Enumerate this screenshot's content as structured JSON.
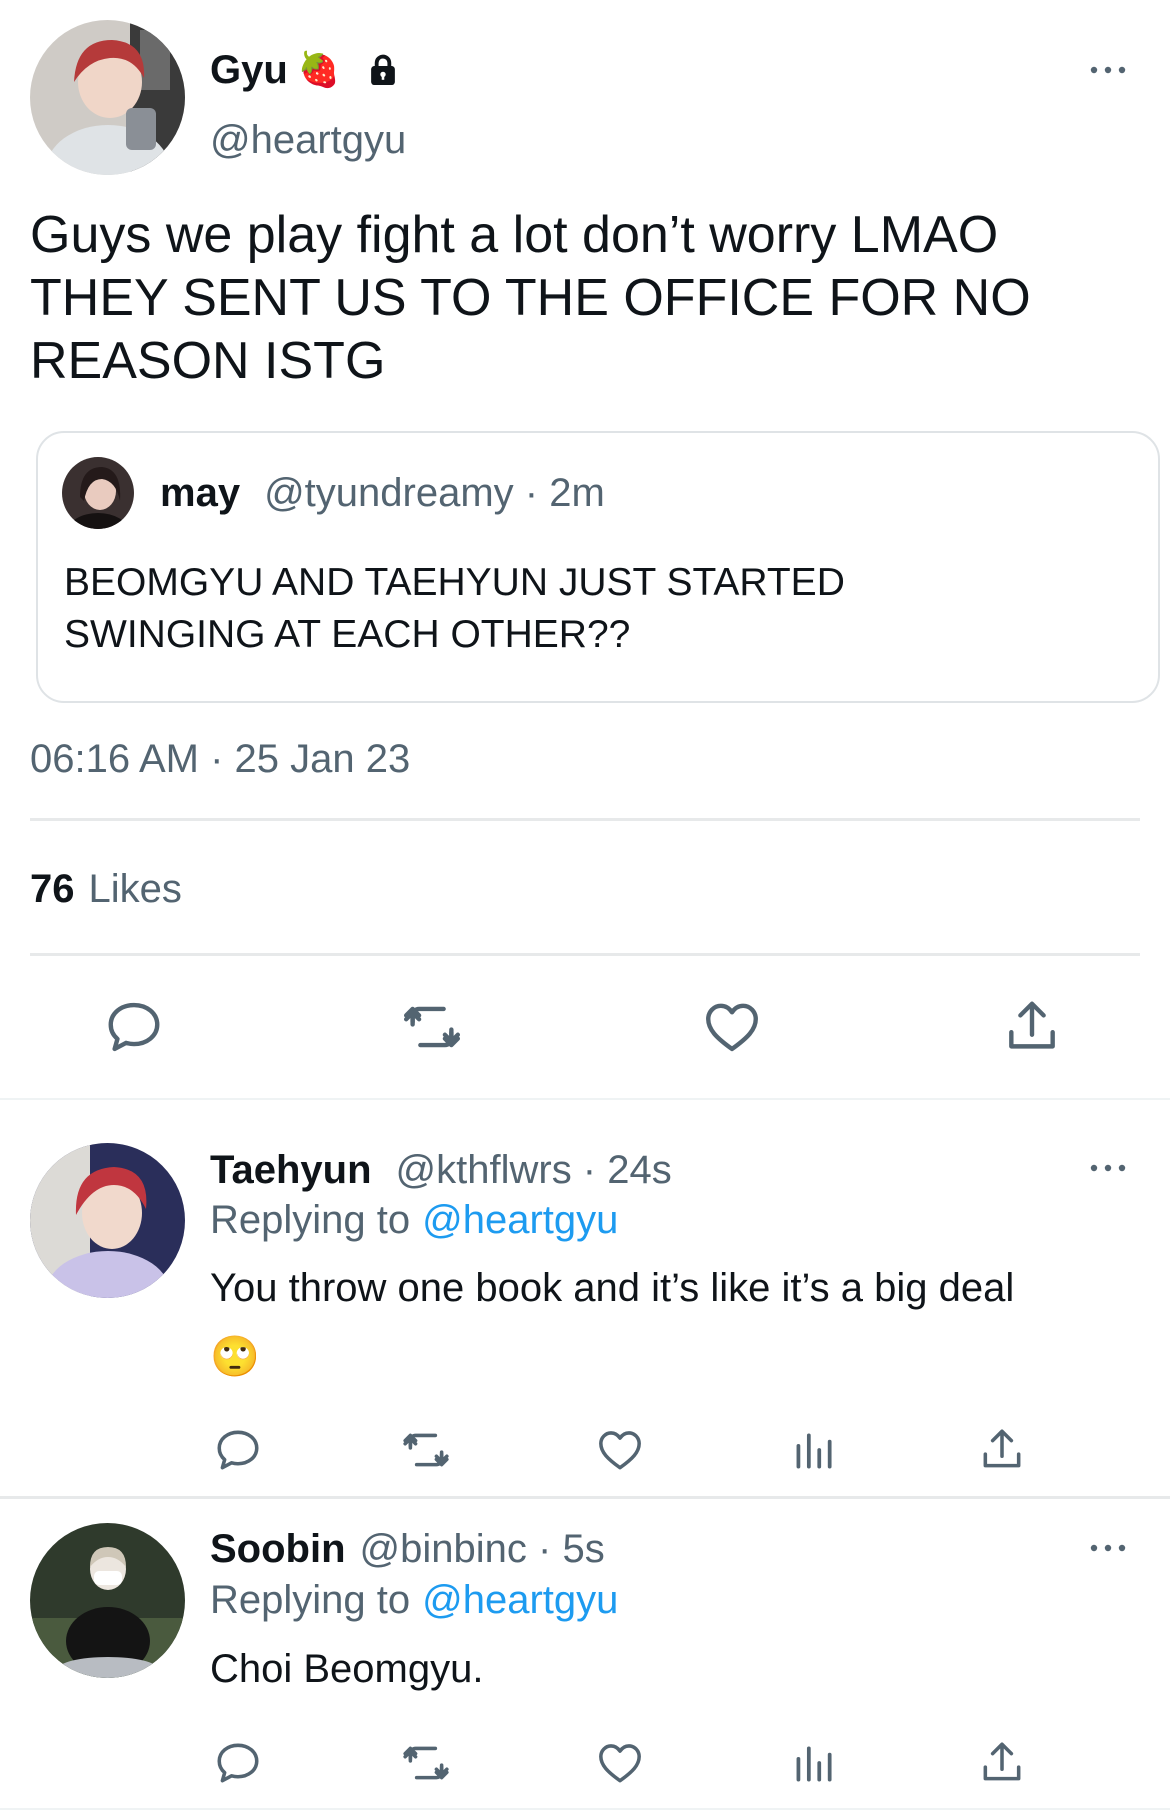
{
  "main_tweet": {
    "display_name": "Gyu",
    "name_emoji": "🍓",
    "handle": "@heartgyu",
    "text_lines": [
      "Guys we play fight a lot don’t worry LMAO",
      "THEY SENT US TO THE OFFICE FOR NO",
      "REASON ISTG"
    ],
    "timestamp": "06:16 AM · 25 Jan 23",
    "likes_count": "76",
    "likes_label": "Likes",
    "quote": {
      "display_name": "may",
      "handle_time": "@tyundreamy · 2m",
      "text_lines": [
        "BEOMGYU AND TAEHYUN JUST STARTED",
        "SWINGING AT EACH OTHER??"
      ]
    }
  },
  "replies": [
    {
      "display_name": "Taehyun",
      "handle_time": "@kthflwrs · 24s",
      "replying_prefix": "Replying to",
      "replying_handle": "@heartgyu",
      "text": "You throw one book and it’s like it’s a big deal",
      "emoji": "🙄"
    },
    {
      "display_name": "Soobin",
      "handle_time": "@binbinc · 5s",
      "replying_prefix": "Replying to",
      "replying_handle": "@heartgyu",
      "text": "Choi Beomgyu."
    }
  ],
  "icons": [
    "more-icon",
    "lock-icon",
    "reply-icon",
    "retweet-icon",
    "like-icon",
    "share-icon",
    "analytics-icon"
  ],
  "colors": {
    "text": "#0f1419",
    "secondary": "#536471",
    "link": "#1d9bf0",
    "divider": "#e7e9ea"
  }
}
